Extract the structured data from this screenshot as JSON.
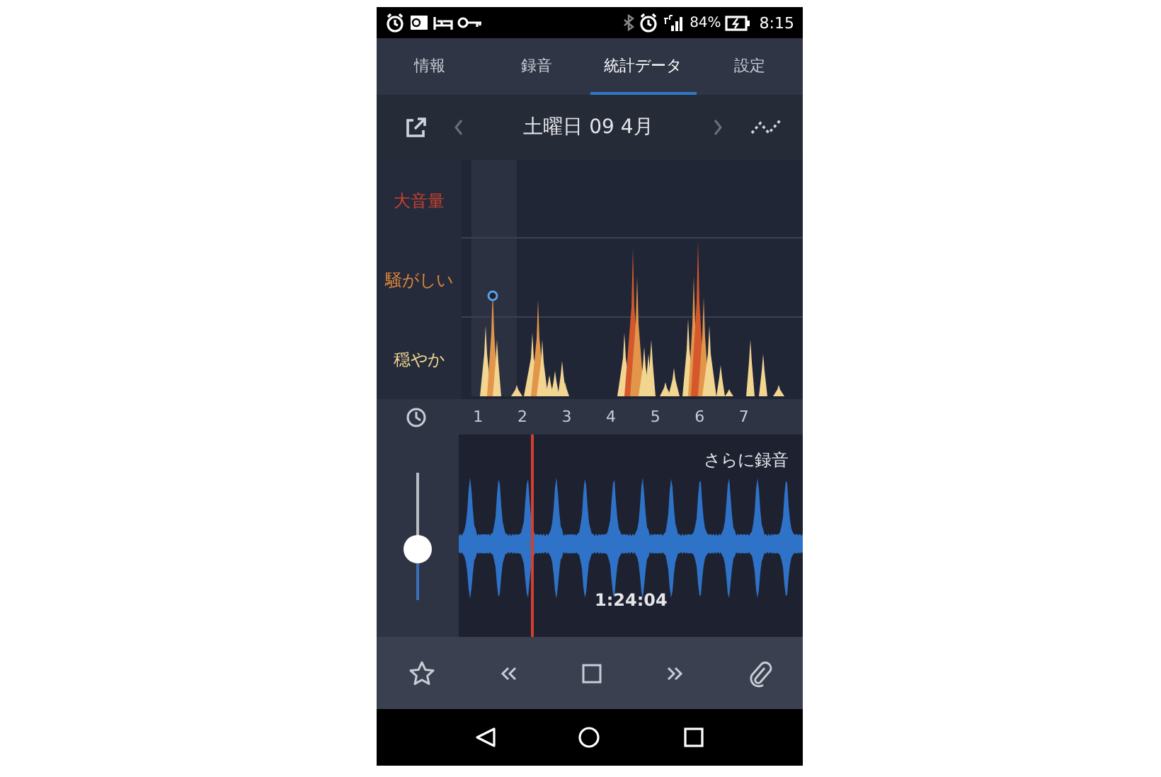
{
  "status_bar": {
    "battery": "84%",
    "time": "8:15"
  },
  "tabs": [
    {
      "label": "情報",
      "selected": false
    },
    {
      "label": "録音",
      "selected": false
    },
    {
      "label": "統計データ",
      "selected": true
    },
    {
      "label": "設定",
      "selected": false
    }
  ],
  "date_bar": {
    "date": "土曜日 09 4月"
  },
  "chart": {
    "levels": [
      {
        "label": "大音量",
        "color": "#c8402f"
      },
      {
        "label": "騒がしい",
        "color": "#e0873a"
      },
      {
        "label": "穏やか",
        "color": "#f0d890"
      }
    ],
    "hours": [
      "1",
      "2",
      "3",
      "4",
      "5",
      "6",
      "7"
    ]
  },
  "recorder": {
    "label": "さらに録音",
    "time": "1:24:04",
    "volume": {
      "level": 0.4
    }
  }
}
